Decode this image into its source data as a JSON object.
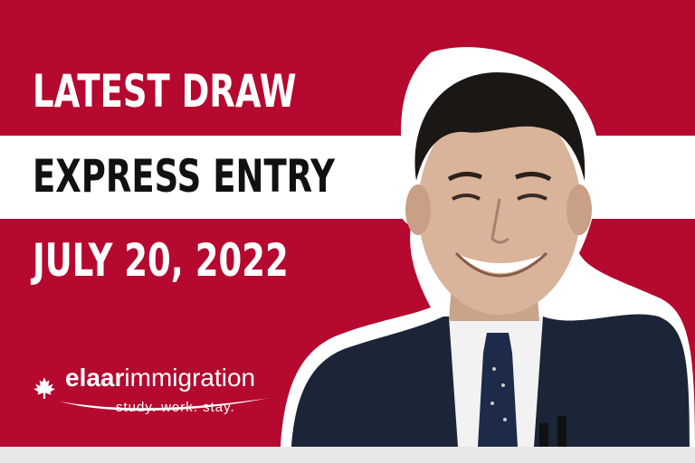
{
  "headline": {
    "line1": "LATEST DRAW",
    "line2": "EXPRESS ENTRY",
    "line3": "JULY 20, 2022"
  },
  "logo": {
    "brand_bold": "elaar",
    "brand_light": "immigration",
    "tagline": "study. work. stay."
  },
  "colors": {
    "background_red": "#b5092f",
    "band_white": "#ffffff",
    "suit": "#1c2438"
  },
  "photo": {
    "subject": "smiling-man-portrait"
  }
}
